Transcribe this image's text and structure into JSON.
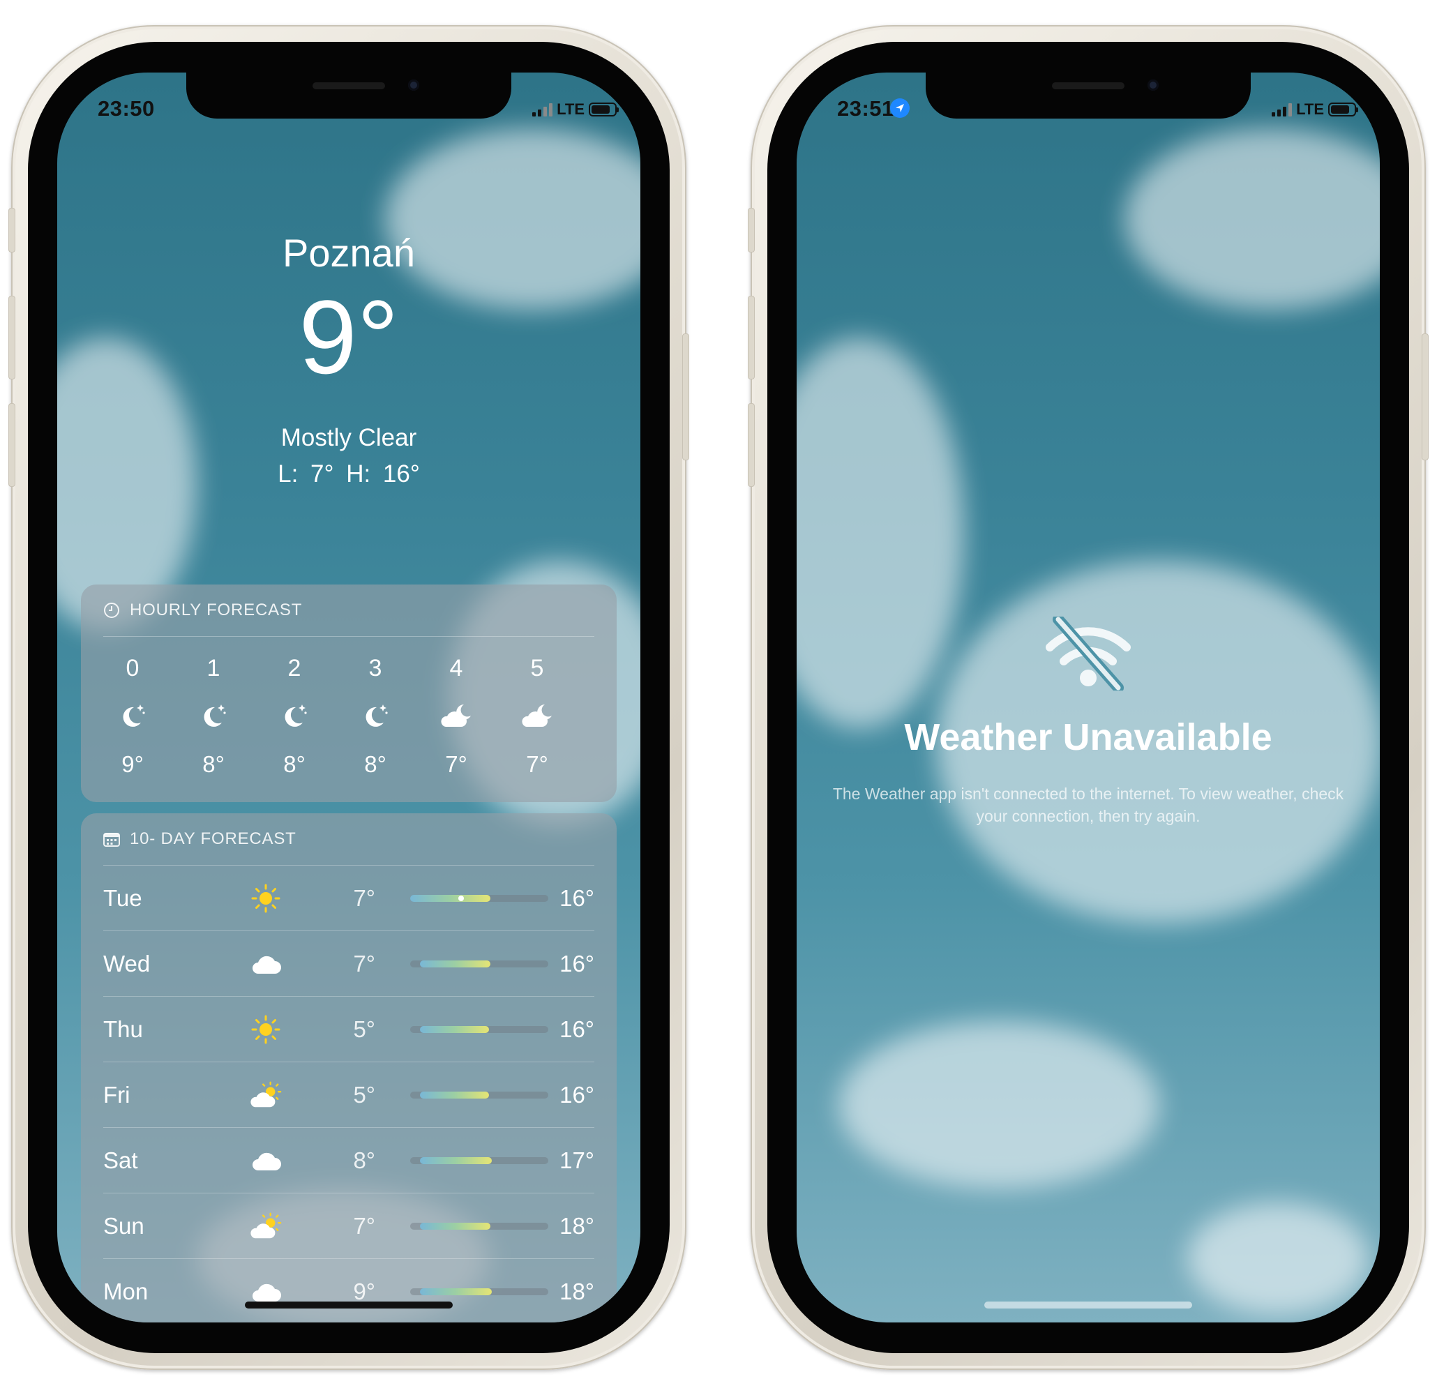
{
  "left_phone": {
    "status": {
      "time": "23:50",
      "network": "LTE"
    },
    "city": "Poznań",
    "temperature": "9°",
    "condition": "Mostly Clear",
    "low_high": "L: 7°  H: 16°",
    "hourly": {
      "title": "HOURLY FORECAST",
      "hours": [
        {
          "hour": "0",
          "icon": "moon-stars-icon",
          "temp": "9°"
        },
        {
          "hour": "1",
          "icon": "moon-stars-icon",
          "temp": "8°"
        },
        {
          "hour": "2",
          "icon": "moon-stars-icon",
          "temp": "8°"
        },
        {
          "hour": "3",
          "icon": "moon-stars-icon",
          "temp": "8°"
        },
        {
          "hour": "4",
          "icon": "cloud-moon-icon",
          "temp": "7°"
        },
        {
          "hour": "5",
          "icon": "cloud-moon-icon",
          "temp": "7°"
        }
      ]
    },
    "daily": {
      "title": "10- DAY FORECAST",
      "days": [
        {
          "day": "Tue",
          "icon": "sun-icon",
          "low": "7°",
          "high": "16°",
          "range_start": 0.0,
          "range_end": 0.58,
          "current_marker": 0.37
        },
        {
          "day": "Wed",
          "icon": "cloud-icon",
          "low": "7°",
          "high": "16°",
          "range_start": 0.07,
          "range_end": 0.58
        },
        {
          "day": "Thu",
          "icon": "sun-icon",
          "low": "5°",
          "high": "16°",
          "range_start": 0.07,
          "range_end": 0.57
        },
        {
          "day": "Fri",
          "icon": "cloud-sun-icon",
          "low": "5°",
          "high": "16°",
          "range_start": 0.07,
          "range_end": 0.57
        },
        {
          "day": "Sat",
          "icon": "cloud-icon",
          "low": "8°",
          "high": "17°",
          "range_start": 0.07,
          "range_end": 0.59
        },
        {
          "day": "Sun",
          "icon": "cloud-sun-icon",
          "low": "7°",
          "high": "18°",
          "range_start": 0.07,
          "range_end": 0.58
        },
        {
          "day": "Mon",
          "icon": "cloud-icon",
          "low": "9°",
          "high": "18°",
          "range_start": 0.07,
          "range_end": 0.59
        }
      ]
    }
  },
  "right_phone": {
    "status": {
      "time": "23:51",
      "network": "LTE",
      "location_icon": "location-arrow-icon"
    },
    "error_icon": "wifi-slash-icon",
    "error_title": "Weather Unavailable",
    "error_message": "The Weather app isn't connected to the internet. To view weather, check your connection, then try again."
  }
}
